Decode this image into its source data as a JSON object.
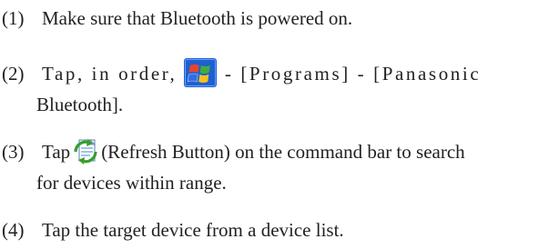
{
  "steps": [
    {
      "number": "(1)",
      "text": "Make sure that Bluetooth is powered on."
    },
    {
      "number": "(2)",
      "text_before_icon": "Tap, in order,",
      "icon": "windows-start-icon",
      "text_after_icon": "- [Programs] - [Panasonic",
      "continuation": "Bluetooth]."
    },
    {
      "number": "(3)",
      "text_before_icon": "Tap",
      "icon": "refresh-button-icon",
      "text_after_icon": "(Refresh Button) on the command bar to search",
      "continuation": "for devices within range."
    },
    {
      "number": "(4)",
      "text": "Tap the target device from a device list."
    }
  ],
  "colors": {
    "text": "#231f20",
    "start_blue": "#1f5fd0",
    "flag_red": "#e8442c",
    "flag_green": "#3fae3c",
    "flag_blue": "#2f6fe0",
    "flag_yellow": "#f6c21a",
    "refresh_green": "#33a02c",
    "refresh_page": "#9fc3ea"
  }
}
